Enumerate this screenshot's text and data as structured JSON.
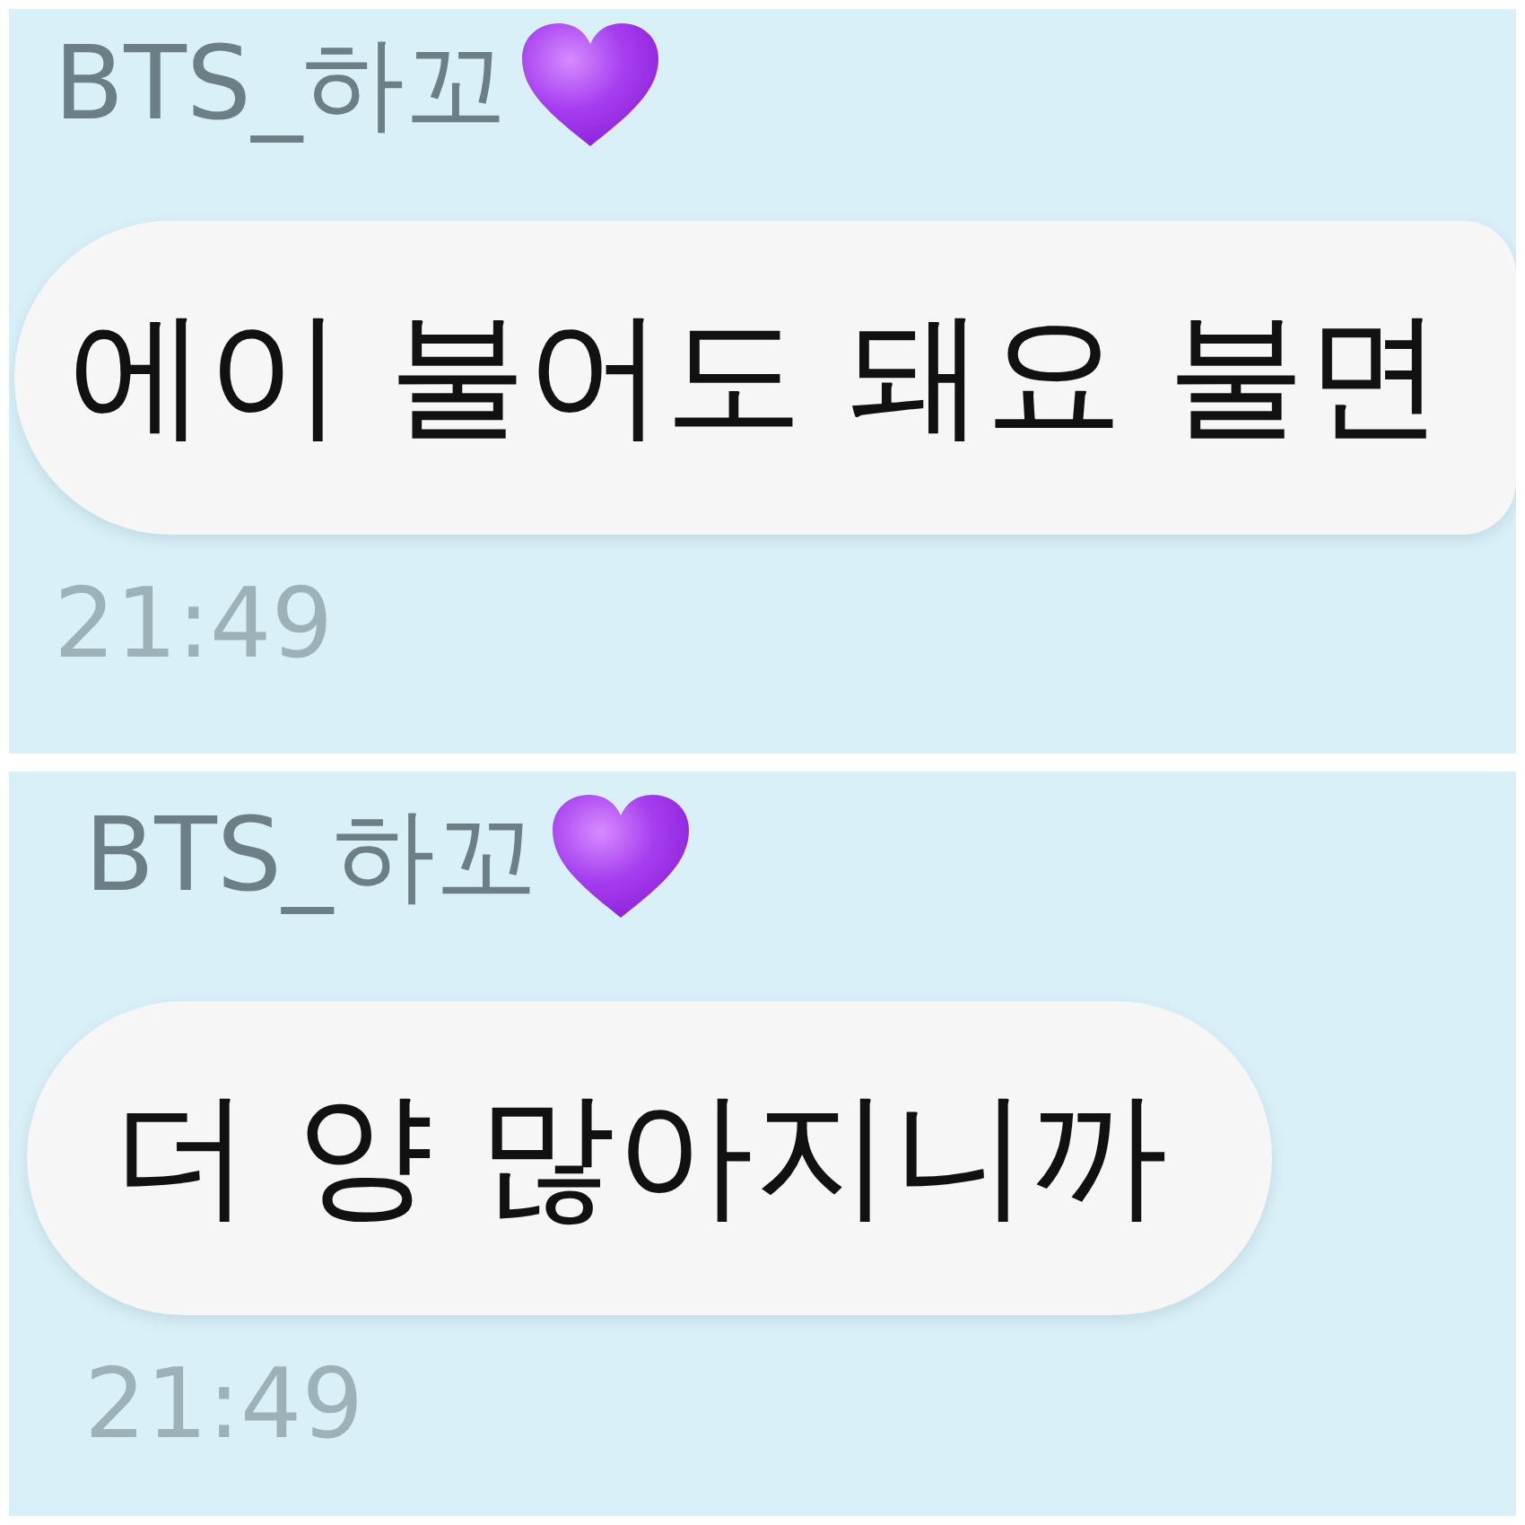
{
  "messages": [
    {
      "sender": "BTS_하꼬",
      "text": "에이 불어도 돼요 불면",
      "time": "21:49"
    },
    {
      "sender": "BTS_하꼬",
      "text": "더 양 많아지니까",
      "time": "21:49"
    }
  ]
}
